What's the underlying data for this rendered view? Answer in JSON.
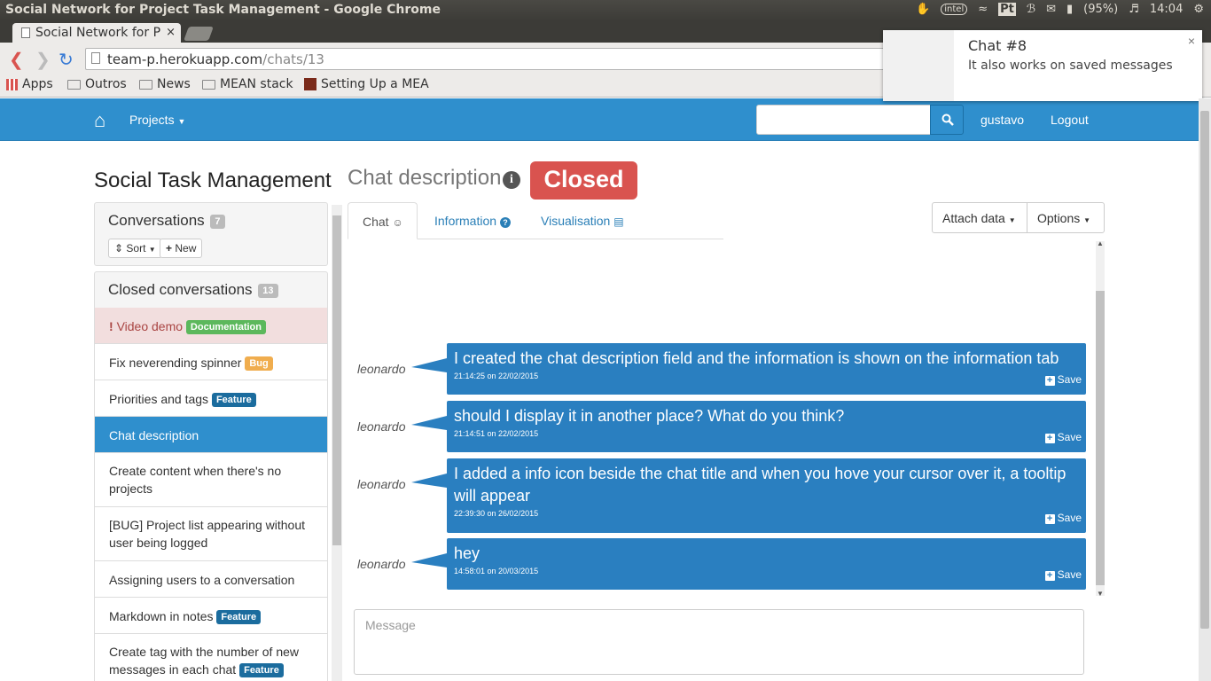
{
  "os": {
    "window_title": "Social Network for Project Task Management - Google Chrome",
    "battery": "(95%)",
    "time": "14:04",
    "input_method": "Pt"
  },
  "browser": {
    "tab_title": "Social Network for P",
    "url_host": "team-p.herokuapp.com",
    "url_path": "/chats/13",
    "bookmarks": [
      "Apps",
      "Outros",
      "News",
      "MEAN stack",
      "Setting Up a MEA"
    ]
  },
  "notification": {
    "title": "Chat #8",
    "body": "It also works on saved messages",
    "close": "×"
  },
  "navbar": {
    "projects_label": "Projects",
    "user": "gustavo",
    "logout": "Logout"
  },
  "page": {
    "app_title": "Social Task Management",
    "chat_title": "Chat description",
    "status": "Closed"
  },
  "conversations": {
    "title": "Conversations",
    "count": "7",
    "sort_label": "Sort",
    "new_label": "New"
  },
  "closed": {
    "title": "Closed conversations",
    "count": "13",
    "items": [
      {
        "label": "Video demo",
        "tag": "Documentation"
      },
      {
        "label": "Fix neverending spinner",
        "tag": "Bug"
      },
      {
        "label": "Priorities and tags",
        "tag": "Feature"
      },
      {
        "label": "Chat description",
        "tag": ""
      },
      {
        "label": "Create content when there's no projects",
        "tag": ""
      },
      {
        "label": "[BUG] Project list appearing without user being logged",
        "tag": ""
      },
      {
        "label": "Assigning users to a conversation",
        "tag": ""
      },
      {
        "label": "Markdown in notes",
        "tag": "Feature"
      },
      {
        "label": "Create tag with the number of new messages in each chat",
        "tag": "Feature"
      }
    ]
  },
  "tabs": {
    "chat": "Chat",
    "information": "Information",
    "visualisation": "Visualisation"
  },
  "toolbar": {
    "attach": "Attach data",
    "options": "Options"
  },
  "messages": [
    {
      "author": "leonardo",
      "text": "I created the chat description field and the information is shown on the information tab",
      "time": "21:14:25 on 22/02/2015",
      "save": "Save"
    },
    {
      "author": "leonardo",
      "text": "should I display it in another place? What do you think?",
      "time": "21:14:51 on 22/02/2015",
      "save": "Save"
    },
    {
      "author": "leonardo",
      "text": "I added a info icon beside the chat title and when you hove your cursor over it, a tooltip will appear",
      "time": "22:39:30 on 26/02/2015",
      "save": "Save"
    },
    {
      "author": "leonardo",
      "text": "hey",
      "time": "14:58:01 on 20/03/2015",
      "save": "Save"
    }
  ],
  "composer": {
    "placeholder": "Message"
  }
}
